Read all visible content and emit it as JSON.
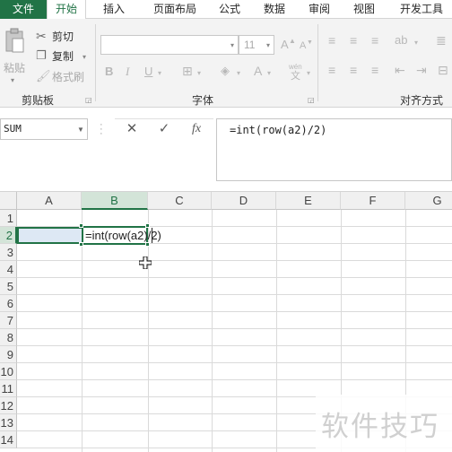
{
  "ribbon_tabs": {
    "file": "文件",
    "home": "开始",
    "insert": "插入",
    "page_layout": "页面布局",
    "formulas": "公式",
    "data": "数据",
    "review": "审阅",
    "view": "视图",
    "developer": "开发工具"
  },
  "clipboard": {
    "paste": "粘贴",
    "cut": "剪切",
    "copy": "复制",
    "format_painter": "格式刷",
    "group_label": "剪贴板"
  },
  "font": {
    "font_name": "",
    "font_size": "11",
    "grow": "A",
    "shrink": "A",
    "bold": "B",
    "italic": "I",
    "underline": "U",
    "font_color": "A",
    "phonetic_top": "wén",
    "phonetic_bottom": "文",
    "group_label": "字体"
  },
  "alignment": {
    "group_label": "对齐方式"
  },
  "formula_bar": {
    "name_box": "SUM",
    "cancel": "✕",
    "enter": "✓",
    "function": "fx",
    "formula": "=int(row(a2)/2)"
  },
  "grid": {
    "columns": [
      "A",
      "B",
      "C",
      "D",
      "E",
      "F",
      "G"
    ],
    "rows": [
      "1",
      "2",
      "3",
      "4",
      "5",
      "6",
      "7",
      "8",
      "9",
      "10",
      "11",
      "12",
      "13",
      "14"
    ],
    "active_cell": "B2",
    "edit_text": "=int(row(a2)/2)"
  },
  "watermark": "软件技巧",
  "colors": {
    "excel_green": "#217346",
    "selection_fill": "#dde8f4",
    "header_gray": "#f0f0f0"
  }
}
